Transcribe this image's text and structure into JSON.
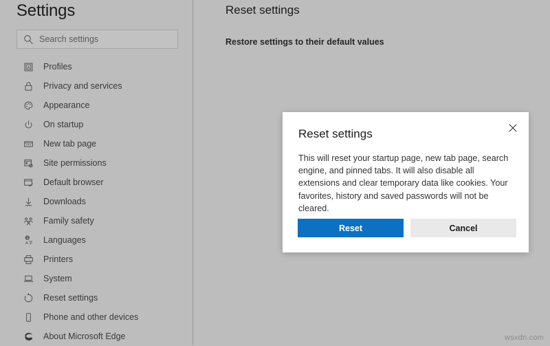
{
  "sidebar": {
    "title": "Settings",
    "search": {
      "placeholder": "Search settings",
      "value": "",
      "icon": "search-icon"
    },
    "items": [
      {
        "label": "Profiles",
        "icon": "profile-card-icon"
      },
      {
        "label": "Privacy and services",
        "icon": "lock-icon"
      },
      {
        "label": "Appearance",
        "icon": "palette-icon"
      },
      {
        "label": "On startup",
        "icon": "power-icon"
      },
      {
        "label": "New tab page",
        "icon": "new-tab-page-icon"
      },
      {
        "label": "Site permissions",
        "icon": "site-permissions-icon"
      },
      {
        "label": "Default browser",
        "icon": "browser-window-check-icon"
      },
      {
        "label": "Downloads",
        "icon": "download-arrow-icon"
      },
      {
        "label": "Family safety",
        "icon": "family-people-icon"
      },
      {
        "label": "Languages",
        "icon": "languages-translate-icon"
      },
      {
        "label": "Printers",
        "icon": "printer-icon"
      },
      {
        "label": "System",
        "icon": "laptop-icon"
      },
      {
        "label": "Reset settings",
        "icon": "reset-circular-arrow-icon"
      },
      {
        "label": "Phone and other devices",
        "icon": "phone-icon"
      },
      {
        "label": "About Microsoft Edge",
        "icon": "edge-logo-icon"
      }
    ]
  },
  "main": {
    "title": "Reset settings",
    "section_heading": "Restore settings to their default values"
  },
  "dialog": {
    "title": "Reset settings",
    "body": "This will reset your startup page, new tab page, search engine, and pinned tabs. It will also disable all extensions and clear temporary data like cookies. Your favorites, history and saved passwords will not be cleared.",
    "primary_button": "Reset",
    "secondary_button": "Cancel",
    "close_icon": "close-icon"
  },
  "watermark": "wsxdn.com",
  "colors": {
    "page_background": "#bdbdbd",
    "dialog_background": "#ffffff",
    "primary_button": "#0c71c3",
    "primary_button_text": "#ffffff",
    "secondary_button": "#e9e9e9",
    "text_primary": "#1b1b1b",
    "text_secondary": "#3a3a3a",
    "divider": "#9a9a9a"
  }
}
